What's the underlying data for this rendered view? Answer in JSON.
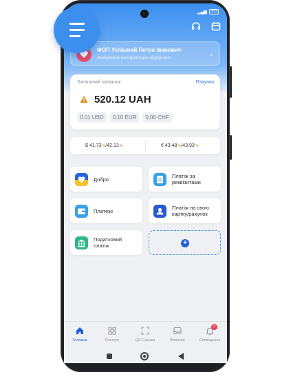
{
  "status": {
    "battery": "100"
  },
  "account": {
    "name": "ФОП Успішний Петро Іванович",
    "subtitle": "Завірений нотаріально підписант"
  },
  "balance": {
    "label": "Загальний залишок",
    "link": "Рахунки",
    "amount": "520.12 UAH",
    "chips": [
      "0.01 USD",
      "0.10 EUR",
      "0.00 CHF"
    ]
  },
  "rates": {
    "usd": {
      "symbol": "$",
      "buy": "41.73",
      "sell": "42.13"
    },
    "eur": {
      "symbol": "€",
      "buy": "43.48",
      "sell": "43.93"
    }
  },
  "tiles": {
    "dobro": "Добро",
    "payment_details_1": "Платіж за",
    "payment_details_2": "реквізитами",
    "payments": "Платежі",
    "own_card_1": "Платіж на свою",
    "own_card_2": "картку/рахунок",
    "tax_1": "Податковий",
    "tax_2": "платіж"
  },
  "tabs": [
    "Головна",
    "Послуги",
    "QR Сканер",
    "Виписка",
    "Сповіщення"
  ],
  "notifications_badge": "9",
  "colors": {
    "accent": "#1f5fd6",
    "hero": "#3a8ff0",
    "warning": "#e08a1e"
  },
  "icons": {
    "menu": "hamburger-icon",
    "support": "headset-icon",
    "calendar": "calendar-icon",
    "home": "home-icon",
    "services": "grid-icon",
    "qr": "qr-scan-icon",
    "statement": "inbox-icon",
    "notifications": "bell-icon"
  }
}
